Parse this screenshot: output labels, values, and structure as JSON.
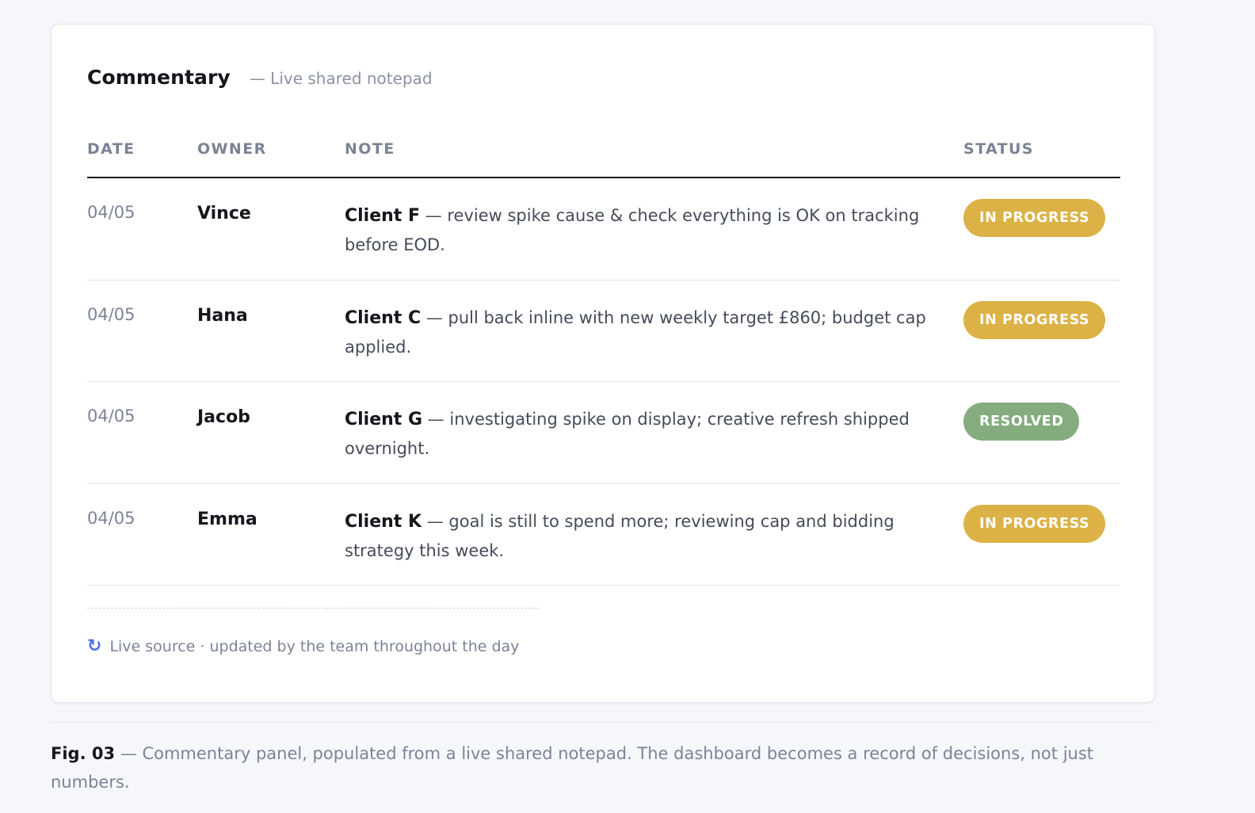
{
  "panel": {
    "title": "Commentary",
    "subtitle": "— Live shared notepad"
  },
  "table": {
    "headers": {
      "date": "DATE",
      "owner": "OWNER",
      "note": "NOTE",
      "status": "STATUS"
    },
    "rows": [
      {
        "date": "04/05",
        "owner": "Vince",
        "client": "Client F",
        "note": " — review spike cause & check everything is OK on tracking before EOD.",
        "status": "IN PROGRESS"
      },
      {
        "date": "04/05",
        "owner": "Hana",
        "client": "Client C",
        "note": " — pull back inline with new weekly target £860; budget cap applied.",
        "status": "IN PROGRESS"
      },
      {
        "date": "04/05",
        "owner": "Jacob",
        "client": "Client G",
        "note": " — investigating spike on display; creative refresh shipped overnight.",
        "status": "RESOLVED"
      },
      {
        "date": "04/05",
        "owner": "Emma",
        "client": "Client K",
        "note": " — goal is still to spend more; reviewing cap and bidding strategy this week.",
        "status": "IN PROGRESS"
      }
    ]
  },
  "footer": {
    "icon": "refresh-icon",
    "live_source": "Live source · updated by the team throughout the day"
  },
  "caption": {
    "label": "Fig. 03",
    "text": " — Commentary panel, populated from a live shared notepad. The dashboard becomes a record of decisions, not just numbers."
  },
  "colors": {
    "in_progress": "#dcb246",
    "resolved": "#84ac7e",
    "accent": "#4f6fe0"
  }
}
